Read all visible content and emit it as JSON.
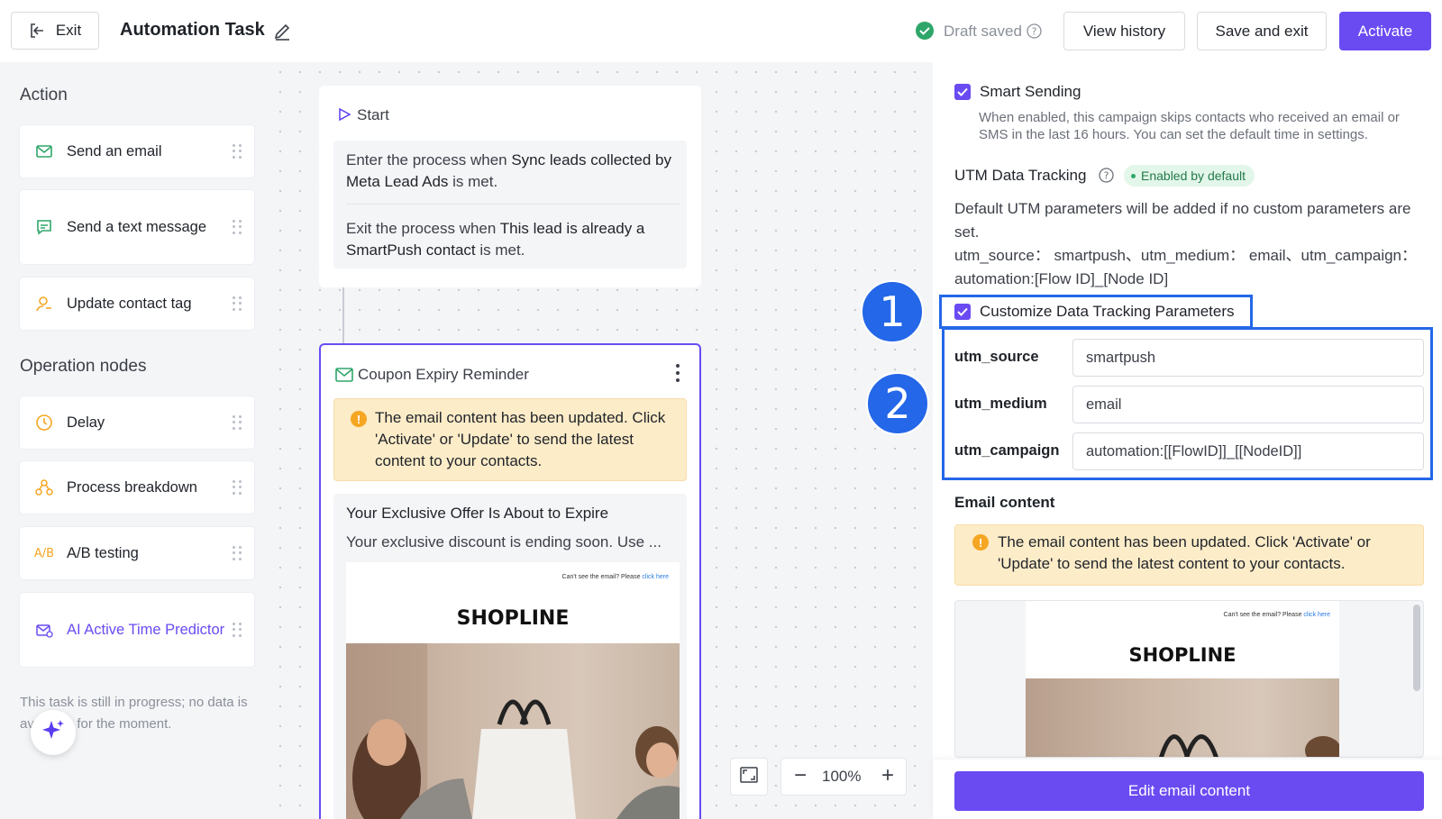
{
  "header": {
    "exit_label": "Exit",
    "title": "Automation Task",
    "draft_status": "Draft saved",
    "view_history_label": "View history",
    "save_exit_label": "Save and exit",
    "activate_label": "Activate"
  },
  "sidebar": {
    "action_heading": "Action",
    "actions": [
      {
        "label": "Send an email",
        "icon": "mail-icon"
      },
      {
        "label": "Send a text message",
        "icon": "sms-icon"
      },
      {
        "label": "Update contact tag",
        "icon": "user-tag-icon"
      }
    ],
    "operation_heading": "Operation nodes",
    "operations": [
      {
        "label": "Delay",
        "icon": "clock-icon"
      },
      {
        "label": "Process breakdown",
        "icon": "branch-icon"
      },
      {
        "label": "A/B testing",
        "icon": "ab-icon"
      },
      {
        "label": "AI Active Time Predictor",
        "icon": "ai-mail-icon"
      }
    ],
    "footer_note": "This task is still in progress; no data is available for the moment."
  },
  "canvas": {
    "start_label": "Start",
    "enter_pre": "Enter the process when ",
    "enter_bold": "Sync leads collected by Meta Lead Ads",
    "enter_post": " is met.",
    "exit_pre": "Exit the process when ",
    "exit_bold": "This lead is already a SmartPush contact",
    "exit_post": " is met.",
    "node_title": "Coupon Expiry Reminder",
    "node_warning": "The email content has been updated. Click 'Activate' or 'Update' to send the latest content to your contacts.",
    "email_subject": "Your Exclusive Offer Is About to Expire",
    "email_preview": "Your exclusive discount is ending soon. Use ...",
    "email_cant_see": "Can't see the email? Please",
    "email_click_here": "click here",
    "brand": "SHOPLINE",
    "zoom": "100%"
  },
  "settings": {
    "smart_sending_label": "Smart Sending",
    "smart_sending_checked": true,
    "smart_sending_desc": "When enabled, this campaign skips contacts who received an email or SMS in the last 16 hours. You can set the default time in settings.",
    "utm_heading": "UTM Data Tracking",
    "utm_badge": "Enabled by default",
    "utm_desc": "Default UTM parameters will be added if no custom parameters are set.",
    "utm_defaults_line1": "utm_source： smartpush、utm_medium： email、utm_campaign：",
    "utm_defaults_line2": "automation:[Flow ID]_[Node ID]",
    "customize_label": "Customize Data Tracking Parameters",
    "customize_checked": true,
    "params": [
      {
        "label": "utm_source",
        "value": "smartpush"
      },
      {
        "label": "utm_medium",
        "value": "email"
      },
      {
        "label": "utm_campaign",
        "value": "automation:[[FlowID]]_[[NodeID]]"
      }
    ],
    "email_content_heading": "Email content",
    "email_warning": "The email content has been updated. Click 'Activate' or 'Update' to send the latest content to your contacts.",
    "edit_button_label": "Edit email content"
  },
  "annotations": {
    "step1": "1",
    "step2": "2"
  },
  "colors": {
    "primary": "#6a4bf2",
    "annotation_blue": "#2467e8",
    "warning_bg": "#fdecc8",
    "success_green": "#2ea66a"
  }
}
